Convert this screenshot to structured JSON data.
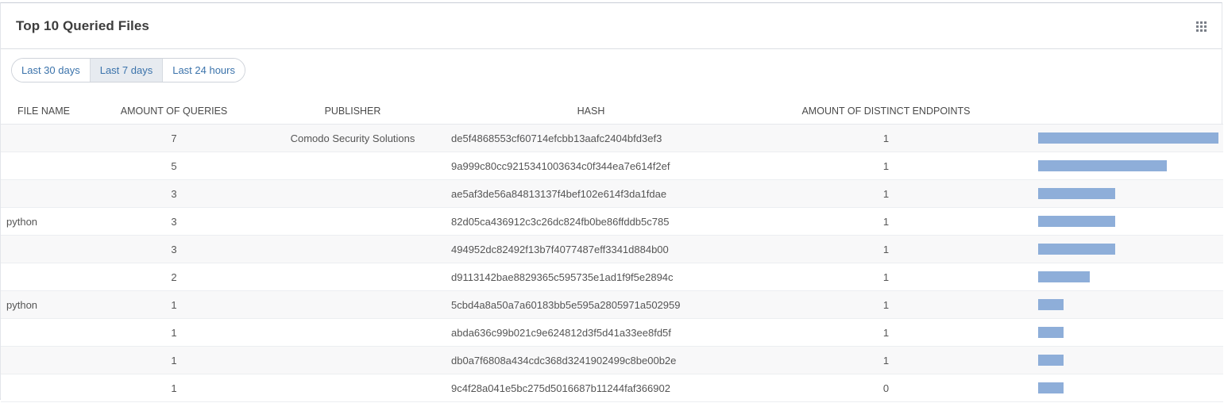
{
  "widget": {
    "title": "Top 10 Queried Files",
    "menu_icon": "grid-icon"
  },
  "filters": [
    {
      "label": "Last 30 days",
      "active": false
    },
    {
      "label": "Last 7 days",
      "active": true
    },
    {
      "label": "Last 24 hours",
      "active": false
    }
  ],
  "table": {
    "columns": {
      "file_name": "FILE NAME",
      "queries": "AMOUNT OF QUERIES",
      "publisher": "PUBLISHER",
      "hash": "HASH",
      "endpoints": "AMOUNT OF DISTINCT ENDPOINTS"
    },
    "max_queries": 7,
    "bar_color": "#8eaed9",
    "rows": [
      {
        "file_name": "",
        "queries": "7",
        "publisher": "Comodo Security Solutions",
        "hash": "de5f4868553cf60714efcbb13aafc2404bfd3ef3",
        "endpoints": "1"
      },
      {
        "file_name": "",
        "queries": "5",
        "publisher": "",
        "hash": "9a999c80cc9215341003634c0f344ea7e614f2ef",
        "endpoints": "1"
      },
      {
        "file_name": "",
        "queries": "3",
        "publisher": "",
        "hash": "ae5af3de56a84813137f4bef102e614f3da1fdae",
        "endpoints": "1"
      },
      {
        "file_name": "python",
        "queries": "3",
        "publisher": "",
        "hash": "82d05ca436912c3c26dc824fb0be86ffddb5c785",
        "endpoints": "1"
      },
      {
        "file_name": "",
        "queries": "3",
        "publisher": "",
        "hash": "494952dc82492f13b7f4077487eff3341d884b00",
        "endpoints": "1"
      },
      {
        "file_name": "",
        "queries": "2",
        "publisher": "",
        "hash": "d9113142bae8829365c595735e1ad1f9f5e2894c",
        "endpoints": "1"
      },
      {
        "file_name": "python",
        "queries": "1",
        "publisher": "",
        "hash": "5cbd4a8a50a7a60183bb5e595a2805971a502959",
        "endpoints": "1"
      },
      {
        "file_name": "",
        "queries": "1",
        "publisher": "",
        "hash": "abda636c99b021c9e624812d3f5d41a33ee8fd5f",
        "endpoints": "1"
      },
      {
        "file_name": "",
        "queries": "1",
        "publisher": "",
        "hash": "db0a7f6808a434cdc368d3241902499c8be00b2e",
        "endpoints": "1"
      },
      {
        "file_name": "",
        "queries": "1",
        "publisher": "",
        "hash": "9c4f28a041e5bc275d5016687b11244faf366902",
        "endpoints": "0"
      }
    ]
  }
}
